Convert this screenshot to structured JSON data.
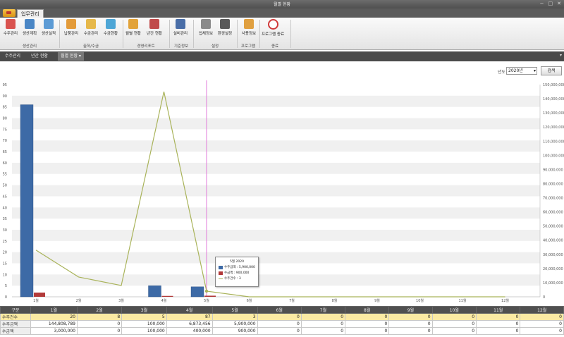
{
  "window": {
    "title": "월별 현황",
    "controls": [
      "−",
      "□",
      "✕"
    ]
  },
  "tabs": [
    {
      "label": "업무관리"
    }
  ],
  "ribbon": {
    "buttons": [
      {
        "label": "수주관리",
        "icon": "order-icon",
        "color": "#d9534f"
      },
      {
        "label": "생산계획",
        "icon": "plan-icon",
        "color": "#4a86c5"
      },
      {
        "label": "생산실적",
        "icon": "production-icon",
        "color": "#5c9bd5"
      },
      {
        "label": "납품관리",
        "icon": "delivery-icon",
        "color": "#e39b3a"
      },
      {
        "label": "수금관리",
        "icon": "collection-icon",
        "color": "#e6b84a"
      },
      {
        "label": "수금현황",
        "icon": "collection-status-icon",
        "color": "#4ea6d6"
      },
      {
        "label": "월별 현황",
        "icon": "monthly-chart-icon",
        "color": "#e2a33a"
      },
      {
        "label": "년간 현황",
        "icon": "yearly-chart-icon",
        "color": "#c04b4b"
      },
      {
        "label": "설비관리",
        "icon": "equipment-icon",
        "color": "#4a6ea8"
      },
      {
        "label": "업체정보",
        "icon": "company-icon",
        "color": "#8a8a8a"
      },
      {
        "label": "환경설정",
        "icon": "settings-icon",
        "color": "#5a5a5a"
      },
      {
        "label": "사용정보",
        "icon": "user-info-icon",
        "color": "#e0a040"
      },
      {
        "label": "프로그램 종료",
        "icon": "exit-icon",
        "color": "#d03a3a"
      }
    ],
    "groups": [
      "생산관리",
      "출하/수금",
      "경영리포트",
      "기준정보",
      "설정",
      "프로그램",
      "종료"
    ]
  },
  "doc_tabs": [
    "수주관리",
    "년간 현황",
    "월별 현황"
  ],
  "toolbar": {
    "year_label": "년도",
    "year_value": "2020년",
    "search_label": "검색"
  },
  "chart_data": {
    "type": "bar",
    "categories": [
      "1월",
      "2월",
      "3월",
      "4월",
      "5월",
      "6월",
      "7월",
      "8월",
      "9월",
      "10월",
      "11월",
      "12월"
    ],
    "series": [
      {
        "name": "수주건수",
        "values": [
          86,
          0,
          0,
          5,
          4.5,
          0,
          0,
          0,
          0,
          0,
          0,
          0
        ],
        "color": "#3d6aa6"
      },
      {
        "name": "수금액",
        "values": [
          1.9,
          0,
          0,
          0.4,
          0.5,
          0,
          0,
          0,
          0,
          0,
          0,
          0
        ],
        "color": "#b23a3a"
      },
      {
        "name": "수주금액",
        "values": [
          33000000,
          14000000,
          8000000,
          145000000,
          4000000,
          0,
          0,
          0,
          0,
          0,
          0,
          0
        ],
        "color": "#a9b35a",
        "axis": "right"
      }
    ],
    "yaxis_left": {
      "ticks": [
        0,
        5,
        10,
        15,
        20,
        25,
        30,
        35,
        40,
        45,
        50,
        55,
        60,
        65,
        70,
        75,
        80,
        85,
        90,
        95
      ],
      "max": 95
    },
    "yaxis_right": {
      "ticks": [
        "0",
        "10,000,000",
        "20,000,000",
        "30,000,000",
        "40,000,000",
        "50,000,000",
        "60,000,000",
        "70,000,000",
        "80,000,000",
        "90,000,000",
        "100,000,000",
        "110,000,000",
        "120,000,000",
        "130,000,000",
        "140,000,000",
        "150,000,000"
      ],
      "max": 150000000
    },
    "crosshair_category": "5월",
    "grid": true
  },
  "tooltip": {
    "title": "5월 2020",
    "rows": [
      {
        "text": "수주금액 : 5,900,000",
        "color": "#3d6aa6",
        "kind": "bar"
      },
      {
        "text": "수금액 : 900,000",
        "color": "#b23a3a",
        "kind": "bar"
      },
      {
        "text": "수주건수 : 3",
        "color": "#a9b35a",
        "kind": "line"
      }
    ]
  },
  "grid_table": {
    "headers": [
      "구분",
      "1월",
      "2월",
      "3월",
      "4월",
      "5월",
      "6월",
      "7월",
      "8월",
      "9월",
      "10월",
      "11월",
      "12월"
    ],
    "rows": [
      {
        "name": "수주건수",
        "values": [
          "20",
          "8",
          "5",
          "87",
          "3",
          "0",
          "0",
          "0",
          "0",
          "0",
          "0",
          "0"
        ]
      },
      {
        "name": "수주금액",
        "values": [
          "144,808,789",
          "0",
          "100,000",
          "6,873,456",
          "5,900,000",
          "0",
          "0",
          "0",
          "0",
          "0",
          "0",
          "0"
        ]
      },
      {
        "name": "수금액",
        "values": [
          "3,000,000",
          "0",
          "100,000",
          "400,000",
          "900,000",
          "0",
          "0",
          "0",
          "0",
          "0",
          "0",
          "0"
        ]
      }
    ]
  }
}
